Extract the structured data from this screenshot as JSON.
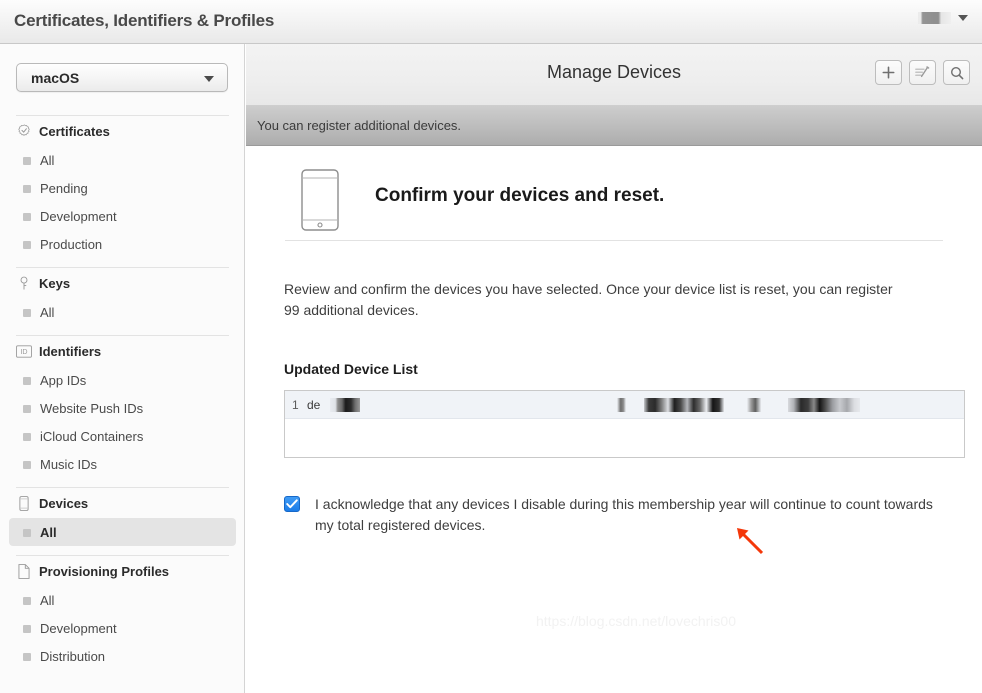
{
  "window": {
    "title": "Certificates, Identifiers & Profiles",
    "account_redacted": true,
    "account_caret_icon": "caret-down-icon"
  },
  "sidebar": {
    "platform_select": {
      "value": "macOS",
      "caret_icon": "caret-down-icon"
    },
    "groups": [
      {
        "label": "Certificates",
        "icon": "certificate-seal-icon",
        "items": [
          {
            "label": "All",
            "selected": false
          },
          {
            "label": "Pending",
            "selected": false
          },
          {
            "label": "Development",
            "selected": false
          },
          {
            "label": "Production",
            "selected": false
          }
        ]
      },
      {
        "label": "Keys",
        "icon": "key-icon",
        "items": [
          {
            "label": "All",
            "selected": false
          }
        ]
      },
      {
        "label": "Identifiers",
        "icon": "id-badge-icon",
        "items": [
          {
            "label": "App IDs",
            "selected": false
          },
          {
            "label": "Website Push IDs",
            "selected": false
          },
          {
            "label": "iCloud Containers",
            "selected": false
          },
          {
            "label": "Music IDs",
            "selected": false
          }
        ]
      },
      {
        "label": "Devices",
        "icon": "device-phone-icon",
        "items": [
          {
            "label": "All",
            "selected": true
          }
        ]
      },
      {
        "label": "Provisioning Profiles",
        "icon": "document-icon",
        "items": [
          {
            "label": "All",
            "selected": false
          },
          {
            "label": "Development",
            "selected": false
          },
          {
            "label": "Distribution",
            "selected": false
          }
        ]
      }
    ]
  },
  "main": {
    "header": {
      "title": "Manage Devices",
      "actions": [
        {
          "name": "add-device-button",
          "icon": "plus-icon"
        },
        {
          "name": "edit-devices-button",
          "icon": "edit-pencil-icon"
        },
        {
          "name": "search-devices-button",
          "icon": "search-icon"
        }
      ]
    },
    "notice": "You can register additional devices.",
    "hero": {
      "icon": "device-phone-icon",
      "title": "Confirm your devices and reset."
    },
    "paragraph": "Review and confirm the devices you have selected. Once your device list is reset, you can register 99 additional devices.",
    "additional_devices_count": "99",
    "device_list": {
      "section_title": "Updated Device List",
      "rows": [
        {
          "index": "1",
          "name": "de",
          "name_redacted": true,
          "detail_redacted": true
        }
      ]
    },
    "acknowledgement": {
      "checked": true,
      "text": "I acknowledge that any devices I disable during this membership year will continue to count towards my total registered devices."
    }
  },
  "annotations": {
    "arrow": {
      "color": "#f4380a",
      "direction": "up-left"
    },
    "watermark": "https://blog.csdn.net/lovechris00"
  },
  "colors": {
    "accent": "#1b7ce8",
    "annotation": "#f4380a",
    "selected_nav": "#e4e4e4"
  }
}
